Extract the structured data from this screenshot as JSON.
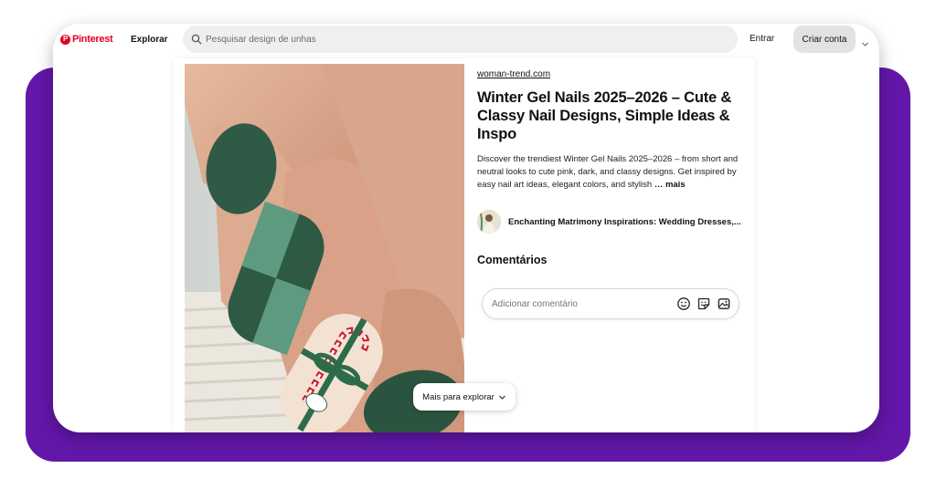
{
  "header": {
    "logo_text": "Pinterest",
    "nav_explore": "Explorar",
    "search_placeholder": "Pesquisar design de unhas",
    "login_label": "Entrar",
    "signup_label": "Criar conta"
  },
  "pin": {
    "source": "woman-trend.com",
    "title": "Winter Gel Nails 2025–2026 – Cute & Classy Nail Designs, Simple Ideas & Inspo",
    "description": "Discover the trendiest Winter Gel Nails 2025–2026 – from short and neutral looks to cute pink, dark, and classy designs. Get inspired by easy nail art ideas, elegant colors, and stylish ",
    "more_label": "… mais",
    "board_name": "Enchanting Matrimony Inspirations: Wedding Dresses,...",
    "comments_heading": "Comentários",
    "comment_placeholder": "Adicionar comentário",
    "comment_icons": [
      "emoji-icon",
      "sticker-icon",
      "image-icon"
    ]
  },
  "explore_more_label": "Mais para explorar",
  "colors": {
    "brand": "#e60023",
    "frame_purple": "#6217a8",
    "nail_green": "#2e5a44"
  }
}
